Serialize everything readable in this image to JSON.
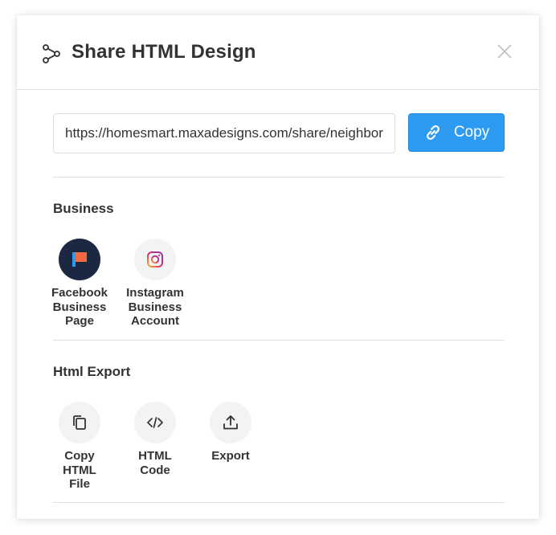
{
  "dialog": {
    "title": "Share HTML Design"
  },
  "share_link": {
    "url": "https://homesmart.maxadesigns.com/share/neighborhood",
    "copy_label": "Copy"
  },
  "sections": {
    "business": {
      "title": "Business",
      "items": [
        {
          "label_lines": [
            "Facebook",
            "Business",
            "Page"
          ],
          "icon": "facebook-flag-icon"
        },
        {
          "label_lines": [
            "Instagram",
            "Business",
            "Account"
          ],
          "icon": "instagram-icon"
        }
      ]
    },
    "html_export": {
      "title": "Html Export",
      "items": [
        {
          "label_lines": [
            "Copy",
            "HTML",
            "File"
          ],
          "icon": "copy-icon"
        },
        {
          "label_lines": [
            "HTML",
            "Code"
          ],
          "icon": "code-icon"
        },
        {
          "label_lines": [
            "Export"
          ],
          "icon": "upload-icon"
        }
      ]
    }
  },
  "colors": {
    "primary": "#2e9bf2",
    "facebook_circle": "#1c2742",
    "flag_orange": "#f26a3d",
    "flag_blue": "#2e9bf2",
    "text": "#333333",
    "divider": "#dcdfe4"
  }
}
